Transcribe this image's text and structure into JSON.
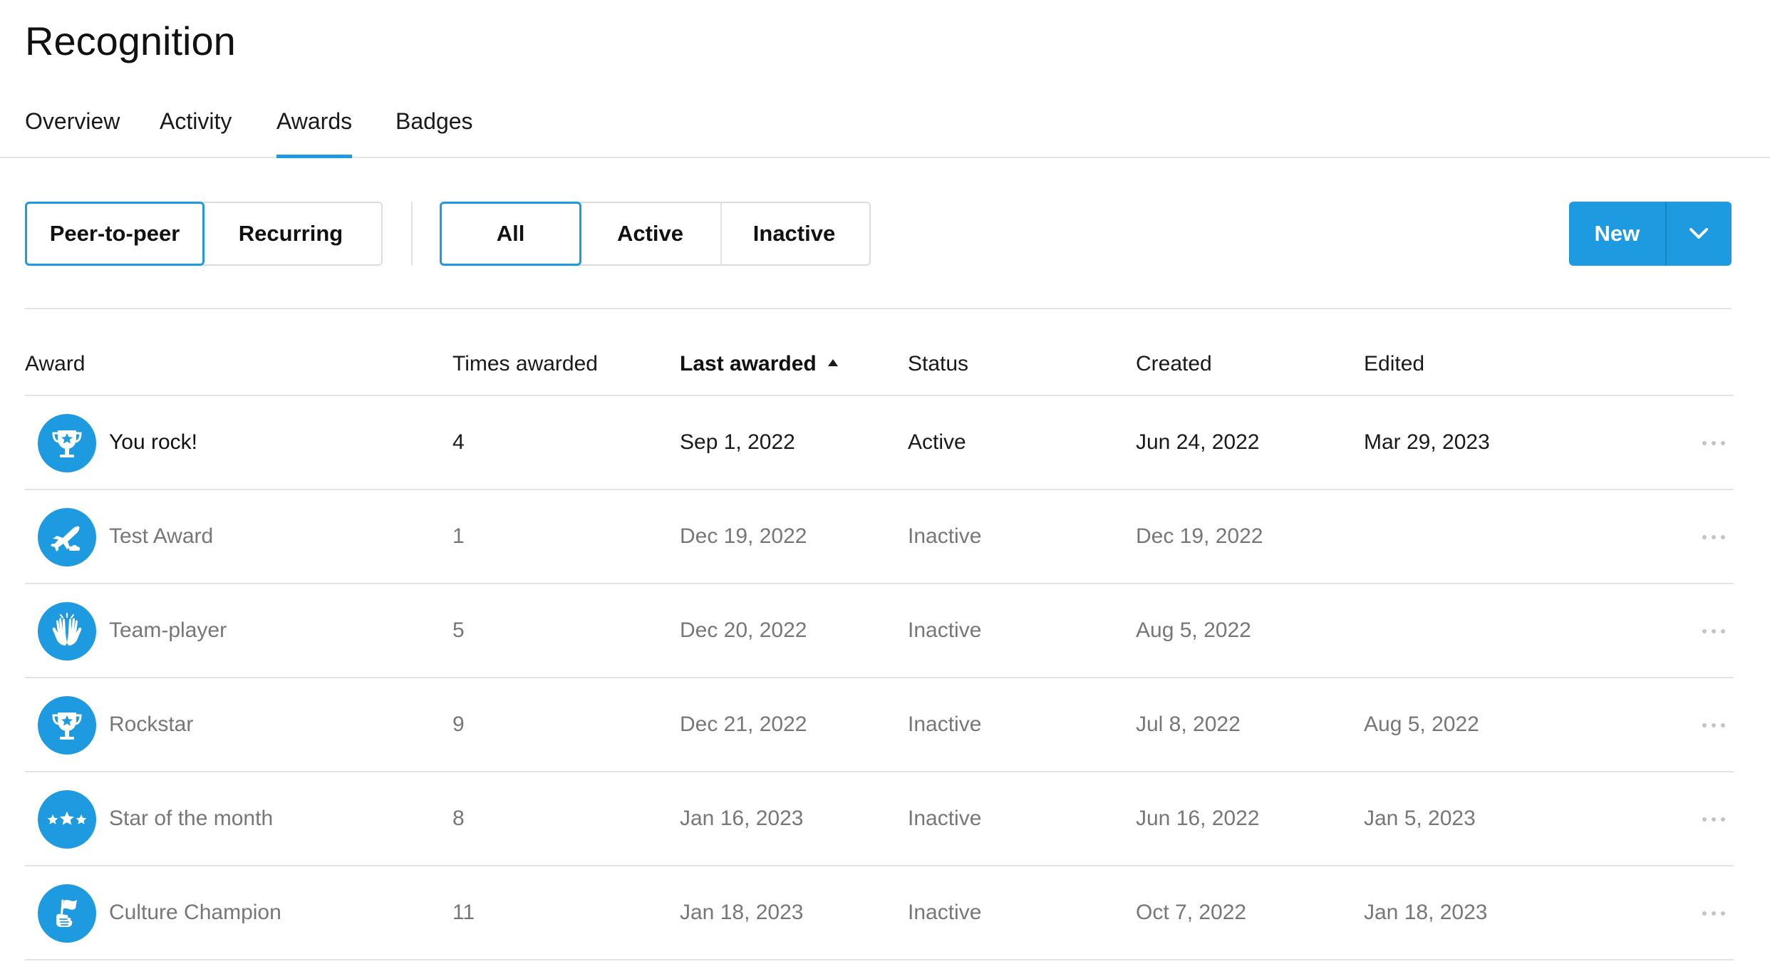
{
  "page": {
    "title": "Recognition"
  },
  "tabs": [
    {
      "label": "Overview"
    },
    {
      "label": "Activity"
    },
    {
      "label": "Awards"
    },
    {
      "label": "Badges"
    }
  ],
  "award_type_filter": {
    "options": [
      "Peer-to-peer",
      "Recurring"
    ],
    "selected": "Peer-to-peer"
  },
  "status_filter": {
    "options": [
      "All",
      "Active",
      "Inactive"
    ],
    "selected": "All"
  },
  "new_button": {
    "label": "New"
  },
  "table": {
    "columns": [
      "Award",
      "Times awarded",
      "Last awarded",
      "Status",
      "Created",
      "Edited"
    ],
    "sorted_column": "Last awarded",
    "rows": [
      {
        "icon": "trophy-icon",
        "name": "You rock!",
        "times": "4",
        "last": "Sep 1, 2022",
        "status": "Active",
        "created": "Jun 24, 2022",
        "edited": "Mar 29, 2023"
      },
      {
        "icon": "airplane-icon",
        "name": "Test Award",
        "times": "1",
        "last": "Dec 19, 2022",
        "status": "Inactive",
        "created": "Dec 19, 2022",
        "edited": ""
      },
      {
        "icon": "high-five-icon",
        "name": "Team-player",
        "times": "5",
        "last": "Dec 20, 2022",
        "status": "Inactive",
        "created": "Aug 5, 2022",
        "edited": ""
      },
      {
        "icon": "trophy-icon",
        "name": "Rockstar",
        "times": "9",
        "last": "Dec 21, 2022",
        "status": "Inactive",
        "created": "Jul 8, 2022",
        "edited": "Aug 5, 2022"
      },
      {
        "icon": "three-stars-icon",
        "name": "Star of the month",
        "times": "8",
        "last": "Jan 16, 2023",
        "status": "Inactive",
        "created": "Jun 16, 2022",
        "edited": "Jan 5, 2023"
      },
      {
        "icon": "flag-hand-icon",
        "name": "Culture Champion",
        "times": "11",
        "last": "Jan 18, 2023",
        "status": "Inactive",
        "created": "Oct 7, 2022",
        "edited": "Jan 18, 2023"
      }
    ]
  },
  "colors": {
    "accent": "#1e9be0",
    "divider": "#e3e3e3",
    "muted_text": "#777777"
  }
}
